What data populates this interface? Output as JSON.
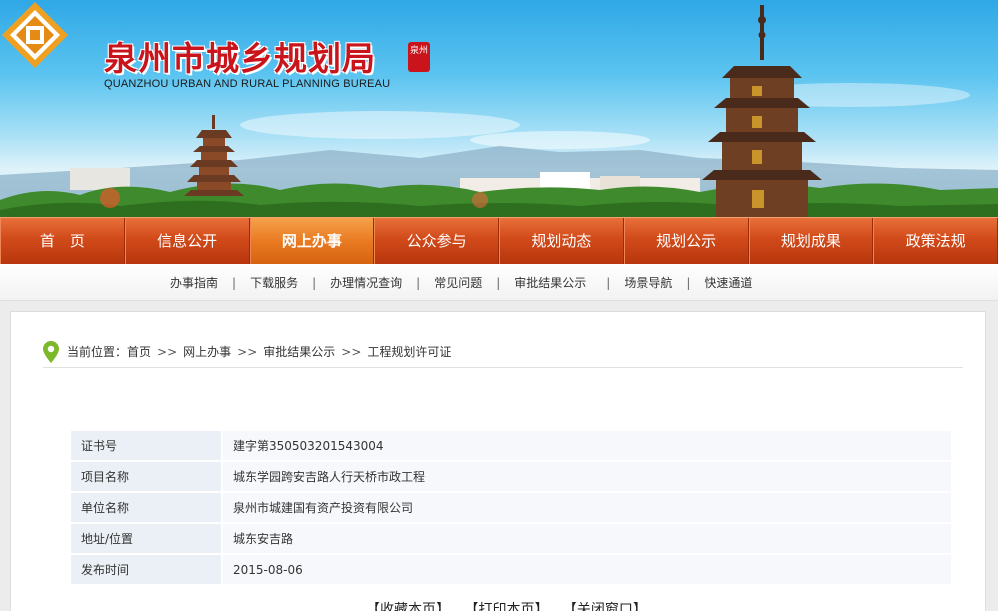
{
  "header": {
    "title": "泉州市城乡规划局",
    "seal_text": "泉州",
    "subtitle": "QUANZHOU URBAN AND RURAL PLANNING BUREAU"
  },
  "nav": {
    "items": [
      {
        "label": "首　页"
      },
      {
        "label": "信息公开"
      },
      {
        "label": "网上办事",
        "active": true
      },
      {
        "label": "公众参与"
      },
      {
        "label": "规划动态"
      },
      {
        "label": "规划公示"
      },
      {
        "label": "规划成果"
      },
      {
        "label": "政策法规"
      }
    ]
  },
  "subnav": {
    "items": [
      {
        "label": "办事指南"
      },
      {
        "label": "下载服务"
      },
      {
        "label": "办理情况查询"
      },
      {
        "label": "常见问题"
      },
      {
        "label": "审批结果公示"
      },
      {
        "label": "场景导航"
      },
      {
        "label": "快速通道"
      }
    ],
    "separator": "|"
  },
  "breadcrumb": {
    "prefix": "当前位置：",
    "items": [
      "首页",
      "网上办事",
      "审批结果公示",
      "工程规划许可证"
    ],
    "separator": ">>"
  },
  "record": {
    "rows": [
      {
        "label": "证书号",
        "value": "建字第350503201543004"
      },
      {
        "label": "项目名称",
        "value": "城东学园跨安吉路人行天桥市政工程"
      },
      {
        "label": "单位名称",
        "value": "泉州市城建国有资产投资有限公司"
      },
      {
        "label": "地址/位置",
        "value": "城东安吉路"
      },
      {
        "label": "发布时间",
        "value": "2015-08-06"
      }
    ]
  },
  "actions": {
    "favorite": "【收藏本页】",
    "print": "【打印本页】",
    "close": "【关闭窗口】"
  },
  "colors": {
    "title_red": "#c8141a",
    "nav_orange": "#d14a1a",
    "nav_active": "#e97a22",
    "label_bg": "#eaf0f6"
  }
}
